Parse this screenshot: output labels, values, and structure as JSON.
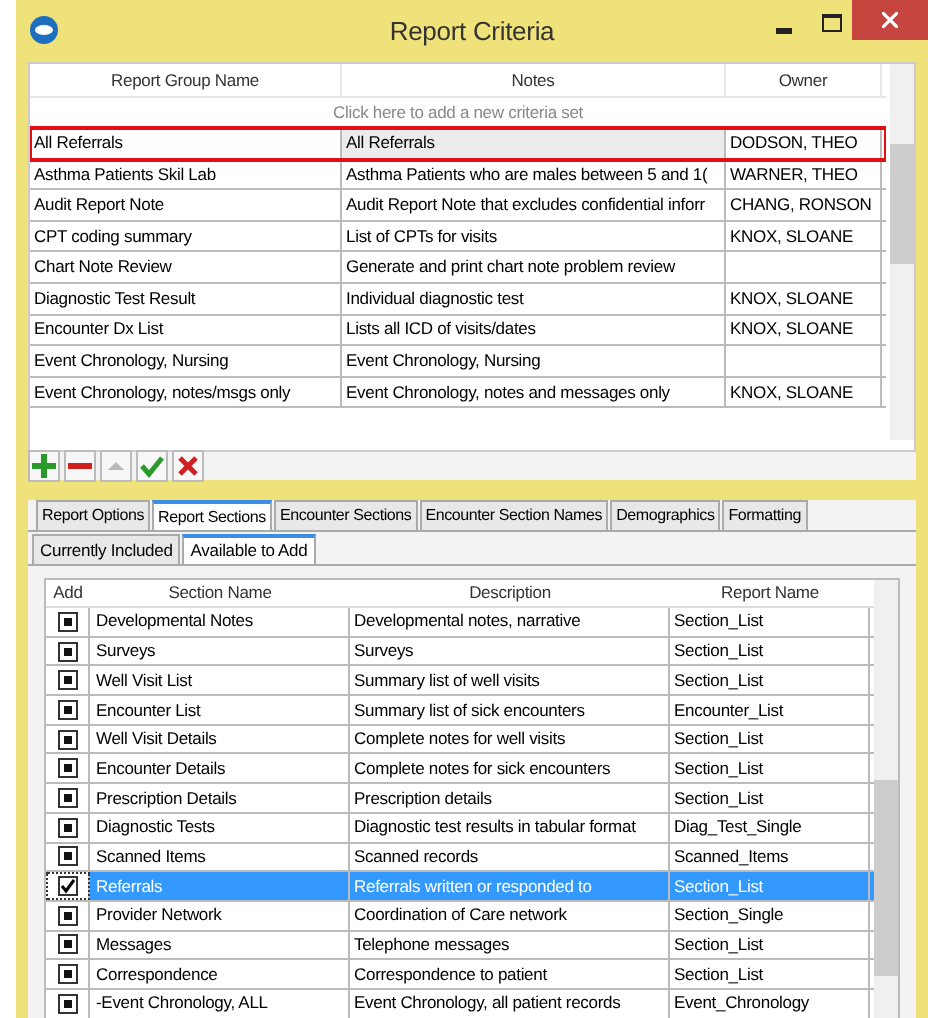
{
  "window": {
    "title": "Report Criteria"
  },
  "criteria_table": {
    "columns": [
      "Report Group Name",
      "Notes",
      "Owner"
    ],
    "add_row": "Click here to add a new criteria set",
    "rows": [
      {
        "name": "All Referrals",
        "notes": "All Referrals",
        "owner": "DODSON, THEO",
        "selected": true
      },
      {
        "name": "Asthma Patients Skil Lab",
        "notes": "Asthma Patients who are males between 5 and 1(",
        "owner": "WARNER, THEO",
        "selected": false
      },
      {
        "name": "Audit Report Note",
        "notes": "Audit Report Note that excludes confidential inforr",
        "owner": "CHANG, RONSON",
        "selected": false
      },
      {
        "name": "CPT coding summary",
        "notes": "List of CPTs for visits",
        "owner": "KNOX, SLOANE",
        "selected": false
      },
      {
        "name": "Chart Note Review",
        "notes": "Generate and print chart note problem review",
        "owner": "",
        "selected": false
      },
      {
        "name": "Diagnostic Test Result",
        "notes": "Individual diagnostic test",
        "owner": "KNOX, SLOANE",
        "selected": false
      },
      {
        "name": "Encounter Dx List",
        "notes": "Lists all ICD of visits/dates",
        "owner": "KNOX, SLOANE",
        "selected": false
      },
      {
        "name": "Event Chronology, Nursing",
        "notes": "Event Chronology, Nursing",
        "owner": "",
        "selected": false
      },
      {
        "name": "Event Chronology, notes/msgs only",
        "notes": "Event Chronology, notes and messages only",
        "owner": "KNOX, SLOANE",
        "selected": false
      }
    ]
  },
  "toolbar": [
    {
      "kind": "add"
    },
    {
      "kind": "remove"
    },
    {
      "kind": "up"
    },
    {
      "kind": "accept"
    },
    {
      "kind": "cancel"
    }
  ],
  "tabs": [
    {
      "label": "Report Options",
      "selected": false
    },
    {
      "label": "Report Sections",
      "selected": true
    },
    {
      "label": "Encounter Sections",
      "selected": false
    },
    {
      "label": "Encounter Section Names",
      "selected": false
    },
    {
      "label": "Demographics",
      "selected": false
    },
    {
      "label": "Formatting",
      "selected": false
    }
  ],
  "subtabs": [
    {
      "label": "Currently Included",
      "selected": false
    },
    {
      "label": "Available to Add",
      "selected": true
    }
  ],
  "sections_table": {
    "columns": [
      "Add",
      "Section Name",
      "Description",
      "Report Name"
    ],
    "rows": [
      {
        "checked": false,
        "selected": false,
        "name": "Developmental Notes",
        "description": "Developmental notes, narrative",
        "report": "Section_List"
      },
      {
        "checked": false,
        "selected": false,
        "name": "Surveys",
        "description": "Surveys",
        "report": "Section_List"
      },
      {
        "checked": false,
        "selected": false,
        "name": "Well Visit List",
        "description": "Summary list of well visits",
        "report": "Section_List"
      },
      {
        "checked": false,
        "selected": false,
        "name": "Encounter List",
        "description": "Summary list of sick encounters",
        "report": "Encounter_List"
      },
      {
        "checked": false,
        "selected": false,
        "name": "Well Visit Details",
        "description": "Complete notes for well visits",
        "report": "Section_List"
      },
      {
        "checked": false,
        "selected": false,
        "name": "Encounter Details",
        "description": "Complete notes for sick encounters",
        "report": "Section_List"
      },
      {
        "checked": false,
        "selected": false,
        "name": "Prescription Details",
        "description": "Prescription details",
        "report": "Section_List"
      },
      {
        "checked": false,
        "selected": false,
        "name": "Diagnostic Tests",
        "description": "Diagnostic test results in tabular format",
        "report": "Diag_Test_Single"
      },
      {
        "checked": false,
        "selected": false,
        "name": "Scanned Items",
        "description": "Scanned records",
        "report": "Scanned_Items"
      },
      {
        "checked": true,
        "selected": true,
        "name": "Referrals",
        "description": "Referrals written or responded to",
        "report": "Section_List"
      },
      {
        "checked": false,
        "selected": false,
        "name": "Provider Network",
        "description": "Coordination of Care network",
        "report": "Section_Single"
      },
      {
        "checked": false,
        "selected": false,
        "name": "Messages",
        "description": "Telephone messages",
        "report": "Section_List"
      },
      {
        "checked": false,
        "selected": false,
        "name": "Correspondence",
        "description": "Correspondence to patient",
        "report": "Section_List"
      },
      {
        "checked": false,
        "selected": false,
        "name": "-Event Chronology, ALL",
        "description": "Event Chronology, all patient records",
        "report": "Event_Chronology"
      }
    ]
  }
}
